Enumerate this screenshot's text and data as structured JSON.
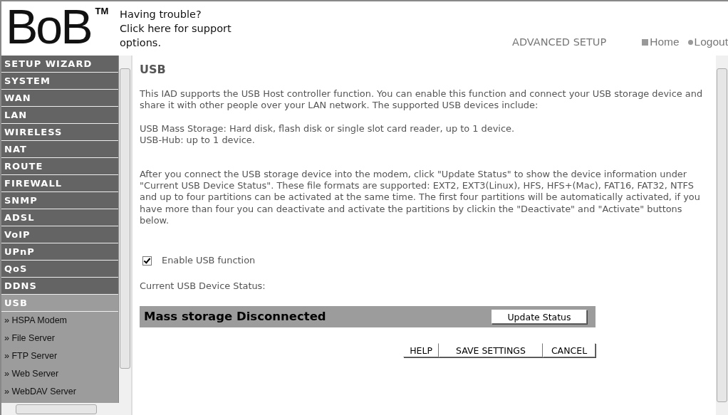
{
  "header": {
    "logo": "BoB",
    "trademark": "TM",
    "support_link": "Having trouble?\nClick here for support options.",
    "section_title": "ADVANCED SETUP",
    "nav_links": [
      {
        "kind": "square",
        "label": "Home"
      },
      {
        "kind": "dot",
        "label": "Logout"
      }
    ]
  },
  "sidebar": {
    "items": [
      {
        "label": "SETUP WIZARD",
        "selected": false
      },
      {
        "label": "SYSTEM",
        "selected": false
      },
      {
        "label": "WAN",
        "selected": false
      },
      {
        "label": "LAN",
        "selected": false
      },
      {
        "label": "WIRELESS",
        "selected": false
      },
      {
        "label": "NAT",
        "selected": false
      },
      {
        "label": "ROUTE",
        "selected": false
      },
      {
        "label": "FIREWALL",
        "selected": false
      },
      {
        "label": "SNMP",
        "selected": false
      },
      {
        "label": "ADSL",
        "selected": false
      },
      {
        "label": "VoIP",
        "selected": false
      },
      {
        "label": "UPnP",
        "selected": false
      },
      {
        "label": "QoS",
        "selected": false
      },
      {
        "label": "DDNS",
        "selected": false
      },
      {
        "label": "USB",
        "selected": true,
        "children": [
          {
            "label": "» HSPA Modem"
          },
          {
            "label": "» File Server"
          },
          {
            "label": "» FTP Server"
          },
          {
            "label": "» Web Server"
          },
          {
            "label": "» WebDAV Server"
          }
        ]
      }
    ]
  },
  "main": {
    "title": "USB",
    "paragraphs": [
      "This IAD supports the USB Host controller function. You can enable this function and connect your USB storage device and share it with other people over your LAN network. The supported USB devices include:",
      "USB Mass Storage: Hard disk, flash disk or single slot card reader, up to 1 device.\nUSB-Hub: up to 1 device.",
      "After you connect the USB storage device into the modem, click \"Update Status\" to show the device information under \"Current USB Device Status\". These file formats are supported: EXT2, EXT3(Linux), HFS, HFS+(Mac), FAT16, FAT32, NTFS and up to four partitions can be activated at the same time. The first four partitions will be automatically activated, if you have more than four you can deactivate and activate the partitions by clickin the \"Deactivate\" and \"Activate\" buttons below."
    ],
    "enable_checkbox": {
      "label": "Enable USB function",
      "checked": true
    },
    "status_label": "Current USB Device Status:",
    "status_bar": {
      "text": "Mass storage Disconnected",
      "button": "Update Status"
    },
    "buttons": [
      "HELP",
      "SAVE SETTINGS",
      "CANCEL"
    ]
  }
}
